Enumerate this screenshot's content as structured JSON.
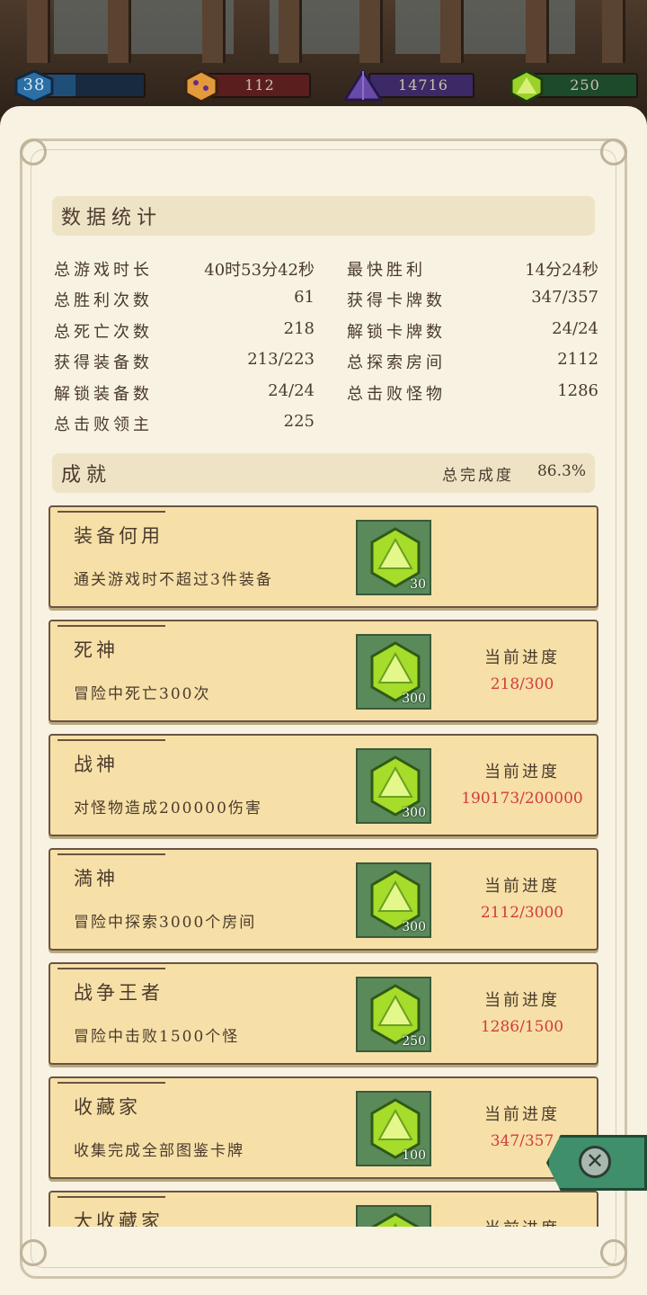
{
  "resources": {
    "level": "38",
    "gold": "112",
    "purple": "14716",
    "green": "250"
  },
  "stats": {
    "title": "数据统计",
    "left": [
      {
        "label": "总游戏时长",
        "value": "40时53分42秒"
      },
      {
        "label": "总胜利次数",
        "value": "61"
      },
      {
        "label": "总死亡次数",
        "value": "218"
      },
      {
        "label": "获得装备数",
        "value": "213/223"
      },
      {
        "label": "解锁装备数",
        "value": "24/24"
      },
      {
        "label": "总击败领主",
        "value": "225"
      }
    ],
    "right": [
      {
        "label": "最快胜利",
        "value": "14分24秒"
      },
      {
        "label": "获得卡牌数",
        "value": "347/357"
      },
      {
        "label": "解锁卡牌数",
        "value": "24/24"
      },
      {
        "label": "总探索房间",
        "value": "2112"
      },
      {
        "label": "总击败怪物",
        "value": "1286"
      }
    ]
  },
  "achievements": {
    "title": "成就",
    "completion_label": "总完成度",
    "completion_value": "86.3%",
    "progress_label": "当前进度",
    "items": [
      {
        "title": "装备何用",
        "desc": "通关游戏时不超过3件装备",
        "reward": "30",
        "progress": ""
      },
      {
        "title": "死神",
        "desc": "冒险中死亡300次",
        "reward": "300",
        "progress": "218/300"
      },
      {
        "title": "战神",
        "desc": "对怪物造成200000伤害",
        "reward": "300",
        "progress": "190173/200000"
      },
      {
        "title": "満神",
        "desc": "冒险中探索3000个房间",
        "reward": "300",
        "progress": "2112/3000"
      },
      {
        "title": "战争王者",
        "desc": "冒险中击败1500个怪",
        "reward": "250",
        "progress": "1286/1500"
      },
      {
        "title": "收藏家",
        "desc": "收集完成全部图鉴卡牌",
        "reward": "100",
        "progress": "347/357"
      },
      {
        "title": "大收藏家",
        "desc": "",
        "reward": "",
        "progress": ""
      }
    ]
  },
  "icons": {
    "level": "shield-icon",
    "gold": "gold-dice-icon",
    "purple": "purple-dice-icon",
    "green": "green-dice-icon",
    "reward": "green-gem-icon",
    "close": "close-icon"
  },
  "colors": {
    "progress_text": "#d33b3b",
    "card_bg": "#f6e0a8",
    "close_button": "#3f8f6a"
  }
}
